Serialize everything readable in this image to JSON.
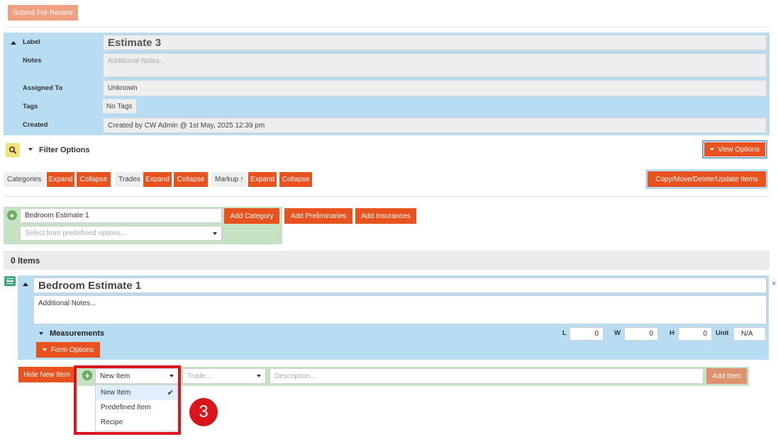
{
  "toolbar": {
    "submit_label": "Submit For Review"
  },
  "estimate": {
    "label_label": "Label",
    "label_value": "Estimate 3",
    "notes_label": "Notes",
    "notes_placeholder": "Additional Notes...",
    "assigned_label": "Assigned To",
    "assigned_value": "Unknown",
    "tags_label": "Tags",
    "tags_value": "No Tags",
    "created_label": "Created",
    "created_value": "Created by CW Admin @ 1st May, 2025 12:39 pm"
  },
  "filter": {
    "title": "Filter Options",
    "view_options_label": "View Options"
  },
  "toggles": {
    "categories_label": "Categories",
    "trades_label": "Trades",
    "markup_label": "Markup",
    "expand_label": "Expand",
    "collapse_label": "Collapse",
    "copy_move_label": "Copy/Move/Delete/Update Items"
  },
  "add_category": {
    "name_value": "Bedroom Estimate 1",
    "predefined_placeholder": "Select from predefined options...",
    "add_category_label": "Add Category",
    "add_preliminaries_label": "Add Preliminaries",
    "add_insurances_label": "Add Insurances"
  },
  "items_count": "0 Items",
  "category": {
    "title": "Bedroom Estimate 1",
    "notes": "Additional Notes...",
    "measurements_label": "Measurements",
    "l_label": "L",
    "l_value": "0",
    "w_label": "W",
    "w_value": "0",
    "h_label": "H",
    "h_value": "0",
    "unit_label": "Unit",
    "unit_value": "N/A",
    "form_options_label": "Form Options"
  },
  "new_item": {
    "hide_label": "Hide New Item",
    "type_selected": "New Item",
    "trade_placeholder": "Trade...",
    "description_placeholder": "Description...",
    "add_item_label": "Add Item",
    "options": [
      "New Item",
      "Predefined Item",
      "Recipe"
    ]
  },
  "annotation": {
    "step_number": "3",
    "highlight_color": "#d9141b"
  },
  "colors": {
    "accent": "#e8521f",
    "panel_blue": "#b8dcf2",
    "panel_green": "#c6e2c4"
  }
}
